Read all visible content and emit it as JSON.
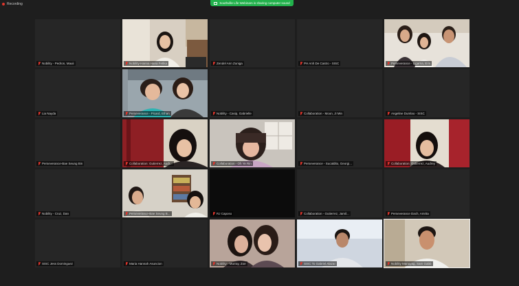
{
  "meeting": {
    "recording_label": "Recording",
    "share_banner": "Southville Life Webinars is sharing computer sound"
  },
  "colors": {
    "background": "#1e1e1e",
    "tile_empty": "#262626",
    "banner_green": "#22b14c",
    "muted_red": "#e0352b",
    "active_border": "#e9e9e9"
  },
  "tiles": [
    {
      "name": "Nobility - Pedron, Mauii",
      "video": false
    },
    {
      "name": "Nobility-Hanna Hana Fetika",
      "video": true
    },
    {
      "name": "Zendel Ann Zuniga",
      "video": false
    },
    {
      "name": "PH Anh De Castro - SISC",
      "video": false
    },
    {
      "name": "Perseverance - Ligarna, Erin",
      "video": true
    },
    {
      "name": "Lia Nayda",
      "video": false
    },
    {
      "name": "Perseverance - Picard, Ethan",
      "video": true
    },
    {
      "name": "Nobility - Casip, Gabrielle",
      "video": false
    },
    {
      "name": "Collaboration - Moon, Ji Min",
      "video": false
    },
    {
      "name": "Angeline Dumlao - SISC",
      "video": false
    },
    {
      "name": "Perseverance-Bae Seung Bin",
      "video": false
    },
    {
      "name": "Collaboration: Gutierrez, Audr...",
      "video": true
    },
    {
      "name": "Collaboration - Oh Ye Rin",
      "video": true
    },
    {
      "name": "Perseverance - Sucaldito, Georgi...",
      "video": false
    },
    {
      "name": "Collaboration: Gutierrez, Audrey",
      "video": true
    },
    {
      "name": "Nobility - Cruz, Dan",
      "video": false
    },
    {
      "name": "Perseverance-Bae Seung B...",
      "video": true
    },
    {
      "name": "RJ Caposo",
      "video": false
    },
    {
      "name": "Collaboration - Gutierrez, Jamil...",
      "video": false
    },
    {
      "name": "Perseverance Dach, Amrita",
      "video": false
    },
    {
      "name": "SISC Jess Dominguez",
      "video": false
    },
    {
      "name": "Maria Hannah Asuncion",
      "video": false
    },
    {
      "name": "Nobility - Murray, Zoe",
      "video": true
    },
    {
      "name": "SISC To Gabriel Alazar",
      "video": true
    },
    {
      "name": "Nobility Manuyag, Sam Gabb",
      "video": true
    }
  ]
}
